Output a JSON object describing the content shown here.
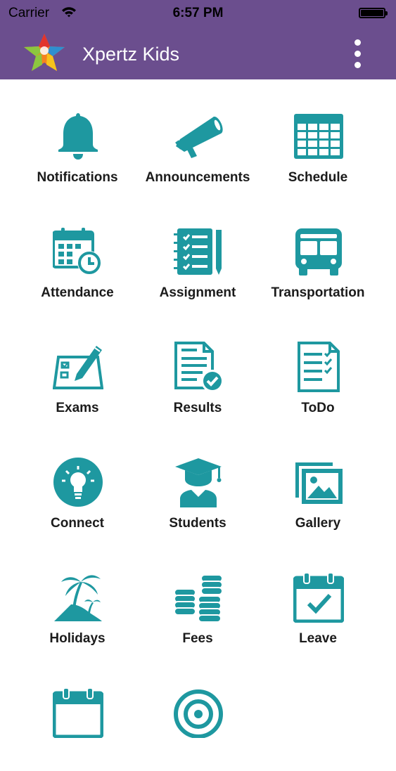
{
  "status_bar": {
    "carrier": "Carrier",
    "time": "6:57 PM"
  },
  "header": {
    "title": "Xpertz Kids",
    "background_color": "#6b4e8e"
  },
  "accent_color": "#1e98a0",
  "menu": [
    {
      "label": "Notifications",
      "icon": "bell-icon"
    },
    {
      "label": "Announcements",
      "icon": "megaphone-icon"
    },
    {
      "label": "Schedule",
      "icon": "table-icon"
    },
    {
      "label": "Attendance",
      "icon": "calendar-clock-icon"
    },
    {
      "label": "Assignment",
      "icon": "checklist-notebook-icon"
    },
    {
      "label": "Transportation",
      "icon": "bus-icon"
    },
    {
      "label": "Exams",
      "icon": "exam-pencil-icon"
    },
    {
      "label": "Results",
      "icon": "document-check-icon"
    },
    {
      "label": "ToDo",
      "icon": "todo-list-icon"
    },
    {
      "label": "Connect",
      "icon": "lightbulb-icon"
    },
    {
      "label": "Students",
      "icon": "graduation-cap-icon"
    },
    {
      "label": "Gallery",
      "icon": "photo-gallery-icon"
    },
    {
      "label": "Holidays",
      "icon": "palm-island-icon"
    },
    {
      "label": "Fees",
      "icon": "coin-stacks-icon"
    },
    {
      "label": "Leave",
      "icon": "calendar-check-icon"
    },
    {
      "label": "",
      "icon": "calendar-icon"
    },
    {
      "label": "",
      "icon": "target-icon"
    }
  ]
}
